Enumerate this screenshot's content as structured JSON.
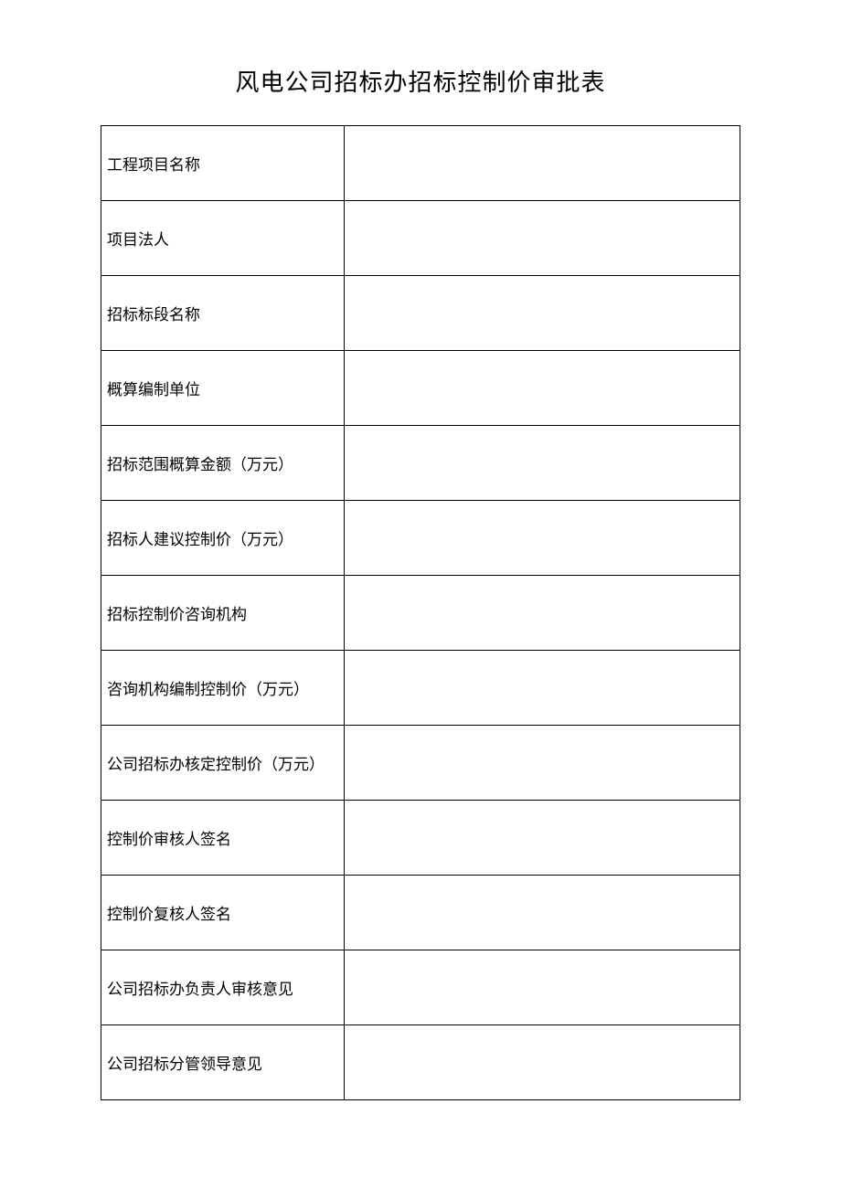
{
  "title": "风电公司招标办招标控制价审批表",
  "rows": [
    {
      "label": "工程项目名称",
      "value": ""
    },
    {
      "label": "项目法人",
      "value": ""
    },
    {
      "label": "招标标段名称",
      "value": ""
    },
    {
      "label": "概算编制单位",
      "value": ""
    },
    {
      "label": "招标范围概算金额（万元）",
      "value": ""
    },
    {
      "label": "招标人建议控制价（万元）",
      "value": ""
    },
    {
      "label": "招标控制价咨询机构",
      "value": ""
    },
    {
      "label": "咨询机构编制控制价（万元）",
      "value": ""
    },
    {
      "label": "公司招标办核定控制价（万元）",
      "value": ""
    },
    {
      "label": "控制价审核人签名",
      "value": ""
    },
    {
      "label": "控制价复核人签名",
      "value": ""
    },
    {
      "label": "公司招标办负责人审核意见",
      "value": ""
    },
    {
      "label": "公司招标分管领导意见",
      "value": ""
    }
  ]
}
